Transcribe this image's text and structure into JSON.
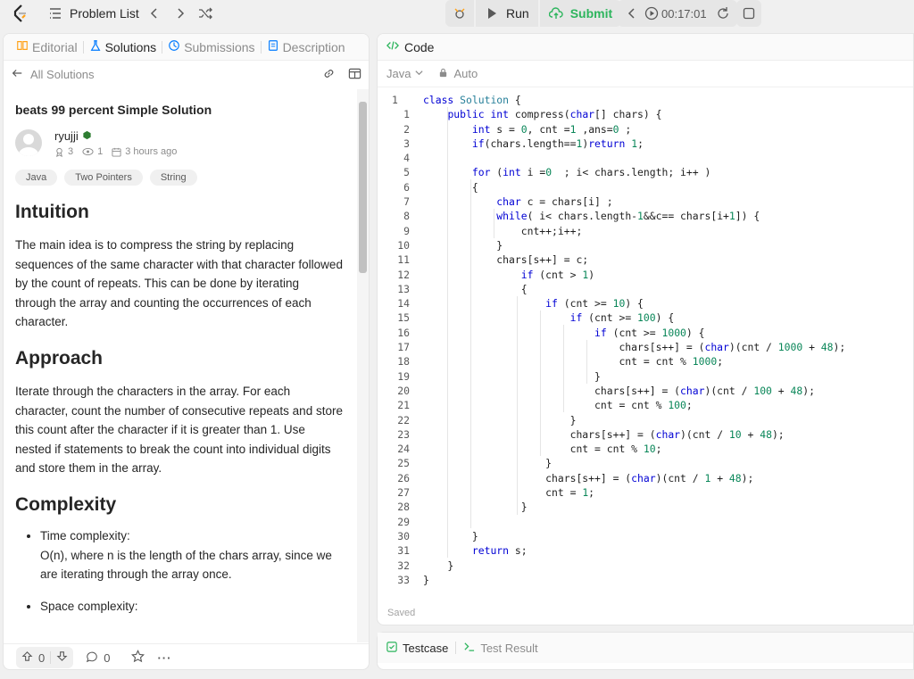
{
  "topbar": {
    "problem_list": "Problem List",
    "run": "Run",
    "submit": "Submit",
    "timer": "00:17:01"
  },
  "left": {
    "tabs": [
      "Editorial",
      "Solutions",
      "Submissions",
      "Description"
    ],
    "all_solutions": "All Solutions",
    "title": "beats 99 percent Simple Solution",
    "author": "ryujji",
    "upvotes_meta": "3",
    "views": "1",
    "time": "3 hours ago",
    "tags": [
      "Java",
      "Two Pointers",
      "String"
    ],
    "h_intuition": "Intuition",
    "intuition": "The main idea is to compress the string by replacing sequences of the same character with that character followed by the count of repeats. This can be done by iterating through the array and counting the occurrences of each character.",
    "h_approach": "Approach",
    "approach": "Iterate through the characters in the array. For each character, count the number of consecutive repeats and store this count after the character if it is greater than 1. Use nested if statements to break the count into individual digits and store them in the array.",
    "h_complexity": "Complexity",
    "time_label": "Time complexity:",
    "time_text": "O(n), where n is the length of the chars array, since we are iterating through the array once.",
    "space_label": "Space complexity:",
    "vote_count": "0",
    "comment_count": "0"
  },
  "code": {
    "header": "Code",
    "lang": "Java",
    "mode": "Auto",
    "saved": "Saved",
    "lines": [
      "class Solution {",
      "    public int compress(char[] chars) {",
      "        int s = 0, cnt =1 ,ans=0 ;",
      "        if(chars.length==1)return 1;",
      "",
      "        for (int i =0  ; i< chars.length; i++ )",
      "        {",
      "            char c = chars[i] ;",
      "            while( i< chars.length-1&&c== chars[i+1]) {",
      "                cnt++;i++;",
      "            }",
      "            chars[s++] = c;",
      "                if (cnt > 1)",
      "                {",
      "                    if (cnt >= 10) {",
      "                        if (cnt >= 100) {",
      "                            if (cnt >= 1000) {",
      "                                chars[s++] = (char)(cnt / 1000 + 48);",
      "                                cnt = cnt % 1000;",
      "                            }",
      "                            chars[s++] = (char)(cnt / 100 + 48);",
      "                            cnt = cnt % 100;",
      "                        }",
      "                        chars[s++] = (char)(cnt / 10 + 48);",
      "                        cnt = cnt % 10;",
      "                    }",
      "                    chars[s++] = (char)(cnt / 1 + 48);",
      "                    cnt = 1;",
      "                }",
      "",
      "        }",
      "        return s;",
      "    }",
      "}"
    ],
    "line_numbers": [
      "1",
      "1",
      "2",
      "3",
      "4",
      "5",
      "6",
      "7",
      "8",
      "9",
      "10",
      "11",
      "12",
      "13",
      "14",
      "15",
      "16",
      "17",
      "18",
      "19",
      "20",
      "21",
      "22",
      "23",
      "24",
      "25",
      "26",
      "27",
      "28",
      "29",
      "30",
      "31",
      "32",
      "33"
    ]
  },
  "test": {
    "testcase": "Testcase",
    "result": "Test Result"
  },
  "colors": {
    "accent_green": "#2db55d",
    "link_blue": "#007aff"
  }
}
